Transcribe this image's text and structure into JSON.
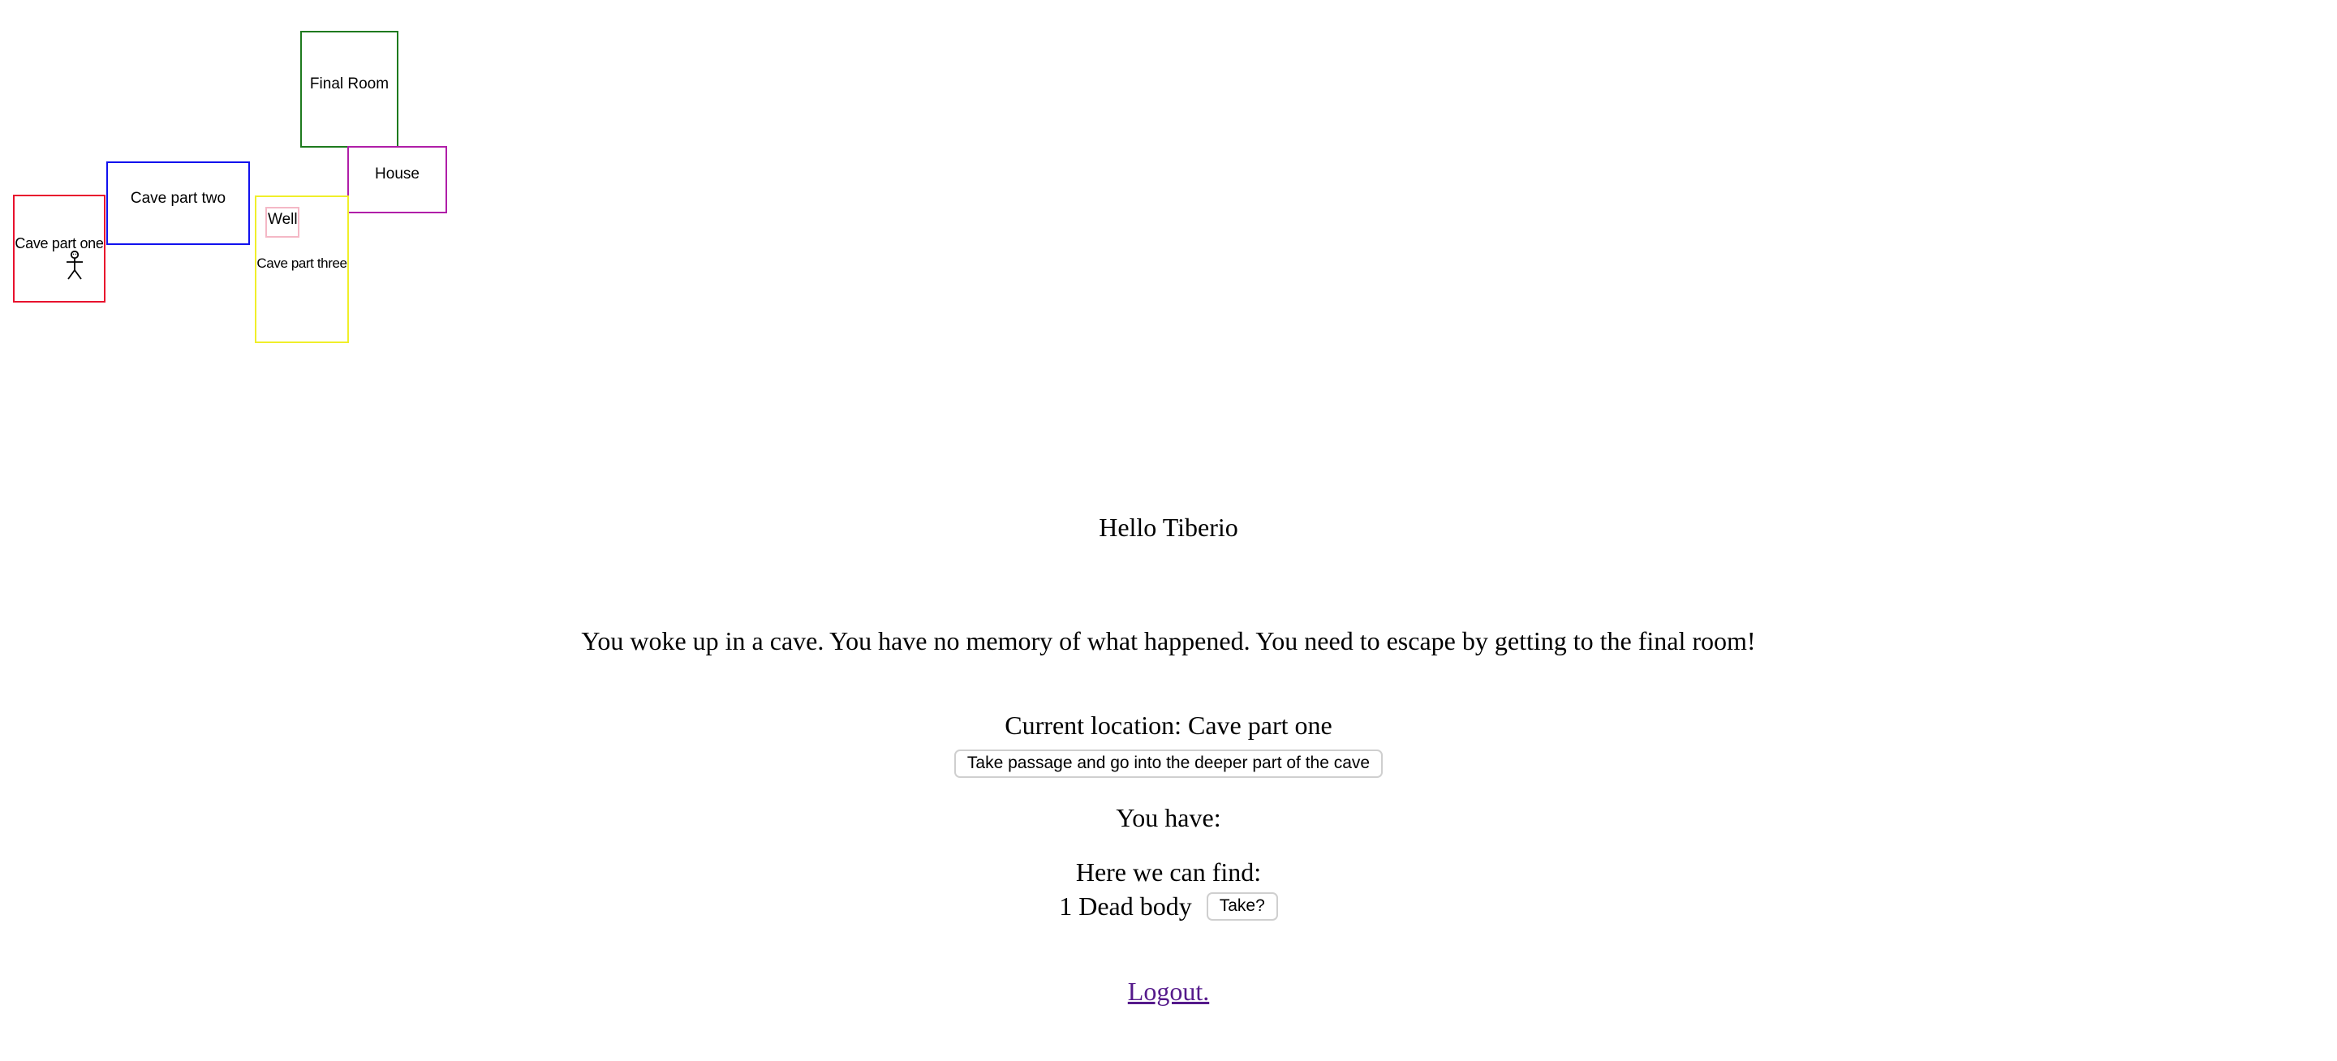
{
  "map": {
    "rooms": {
      "cave1": "Cave part one",
      "cave2": "Cave part two",
      "cave3": "Cave part three",
      "final": "Final Room",
      "house": "House",
      "well": "Well"
    },
    "player_icon": "stick-figure-icon",
    "colors": {
      "cave1": "#e8112d",
      "cave2": "#1111ee",
      "cave3": "#f0ef2a",
      "final": "#1e7a1e",
      "house": "#b01ea8",
      "well": "#f4b8c6"
    }
  },
  "greeting": "Hello Tiberio",
  "intro": "You woke up in a cave. You have no memory of what happened. You need to escape by getting to the final room!",
  "location": "Current location: Cave part one",
  "actions": {
    "passage_button": "Take passage and go into the deeper part of the cave"
  },
  "inventory_label": "You have:",
  "here_label": "Here we can find:",
  "items": [
    {
      "text": "1 Dead body",
      "button": "Take?"
    }
  ],
  "logout": "Logout."
}
